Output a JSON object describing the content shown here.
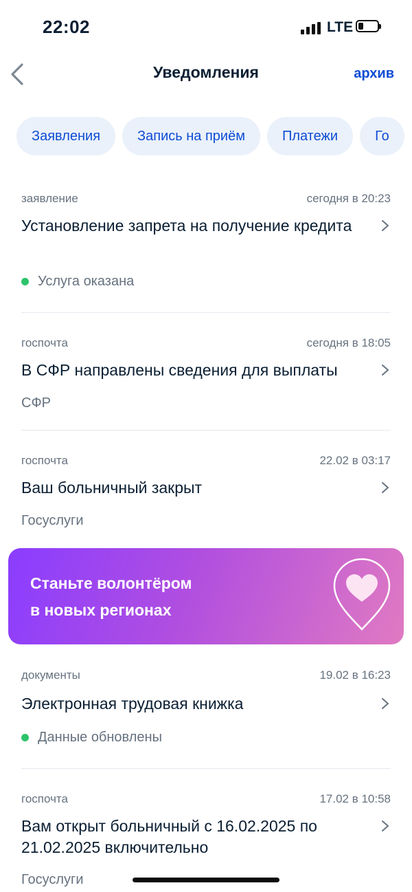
{
  "status_bar": {
    "time": "22:02",
    "network": "LTE",
    "battery_level": 0.25
  },
  "header": {
    "title": "Уведомления",
    "archive_label": "архив"
  },
  "chips": [
    {
      "label": "Заявления"
    },
    {
      "label": "Запись на приём"
    },
    {
      "label": "Платежи"
    },
    {
      "label": "Го"
    }
  ],
  "notifications": [
    {
      "category": "заявление",
      "date": "сегодня в 20:23",
      "title": "Установление запрета на получение кредита",
      "status": "Услуга оказана"
    },
    {
      "category": "госпочта",
      "date": "сегодня в 18:05",
      "title": "В СФР направлены сведения для выплаты",
      "source": "СФР"
    },
    {
      "category": "госпочта",
      "date": "22.02 в 03:17",
      "title": "Ваш больничный закрыт",
      "source": "Госуслуги"
    },
    {
      "category": "документы",
      "date": "19.02 в 16:23",
      "title": "Электронная трудовая книжка",
      "status": "Данные обновлены"
    },
    {
      "category": "госпочта",
      "date": "17.02 в 10:58",
      "title": "Вам открыт больничный с 16.02.2025 по 21.02.2025 включительно",
      "source": "Госуслуги"
    }
  ],
  "banner": {
    "line1": "Станьте волонтёром",
    "line2": "в новых регионах",
    "icon": "heart-pin-icon"
  },
  "colors": {
    "accent": "#0d4cd3",
    "chip_bg": "#eaf1fa",
    "status_dot": "#2dc36a",
    "banner_start": "#8a3dff",
    "banner_end": "#e07ac2"
  }
}
